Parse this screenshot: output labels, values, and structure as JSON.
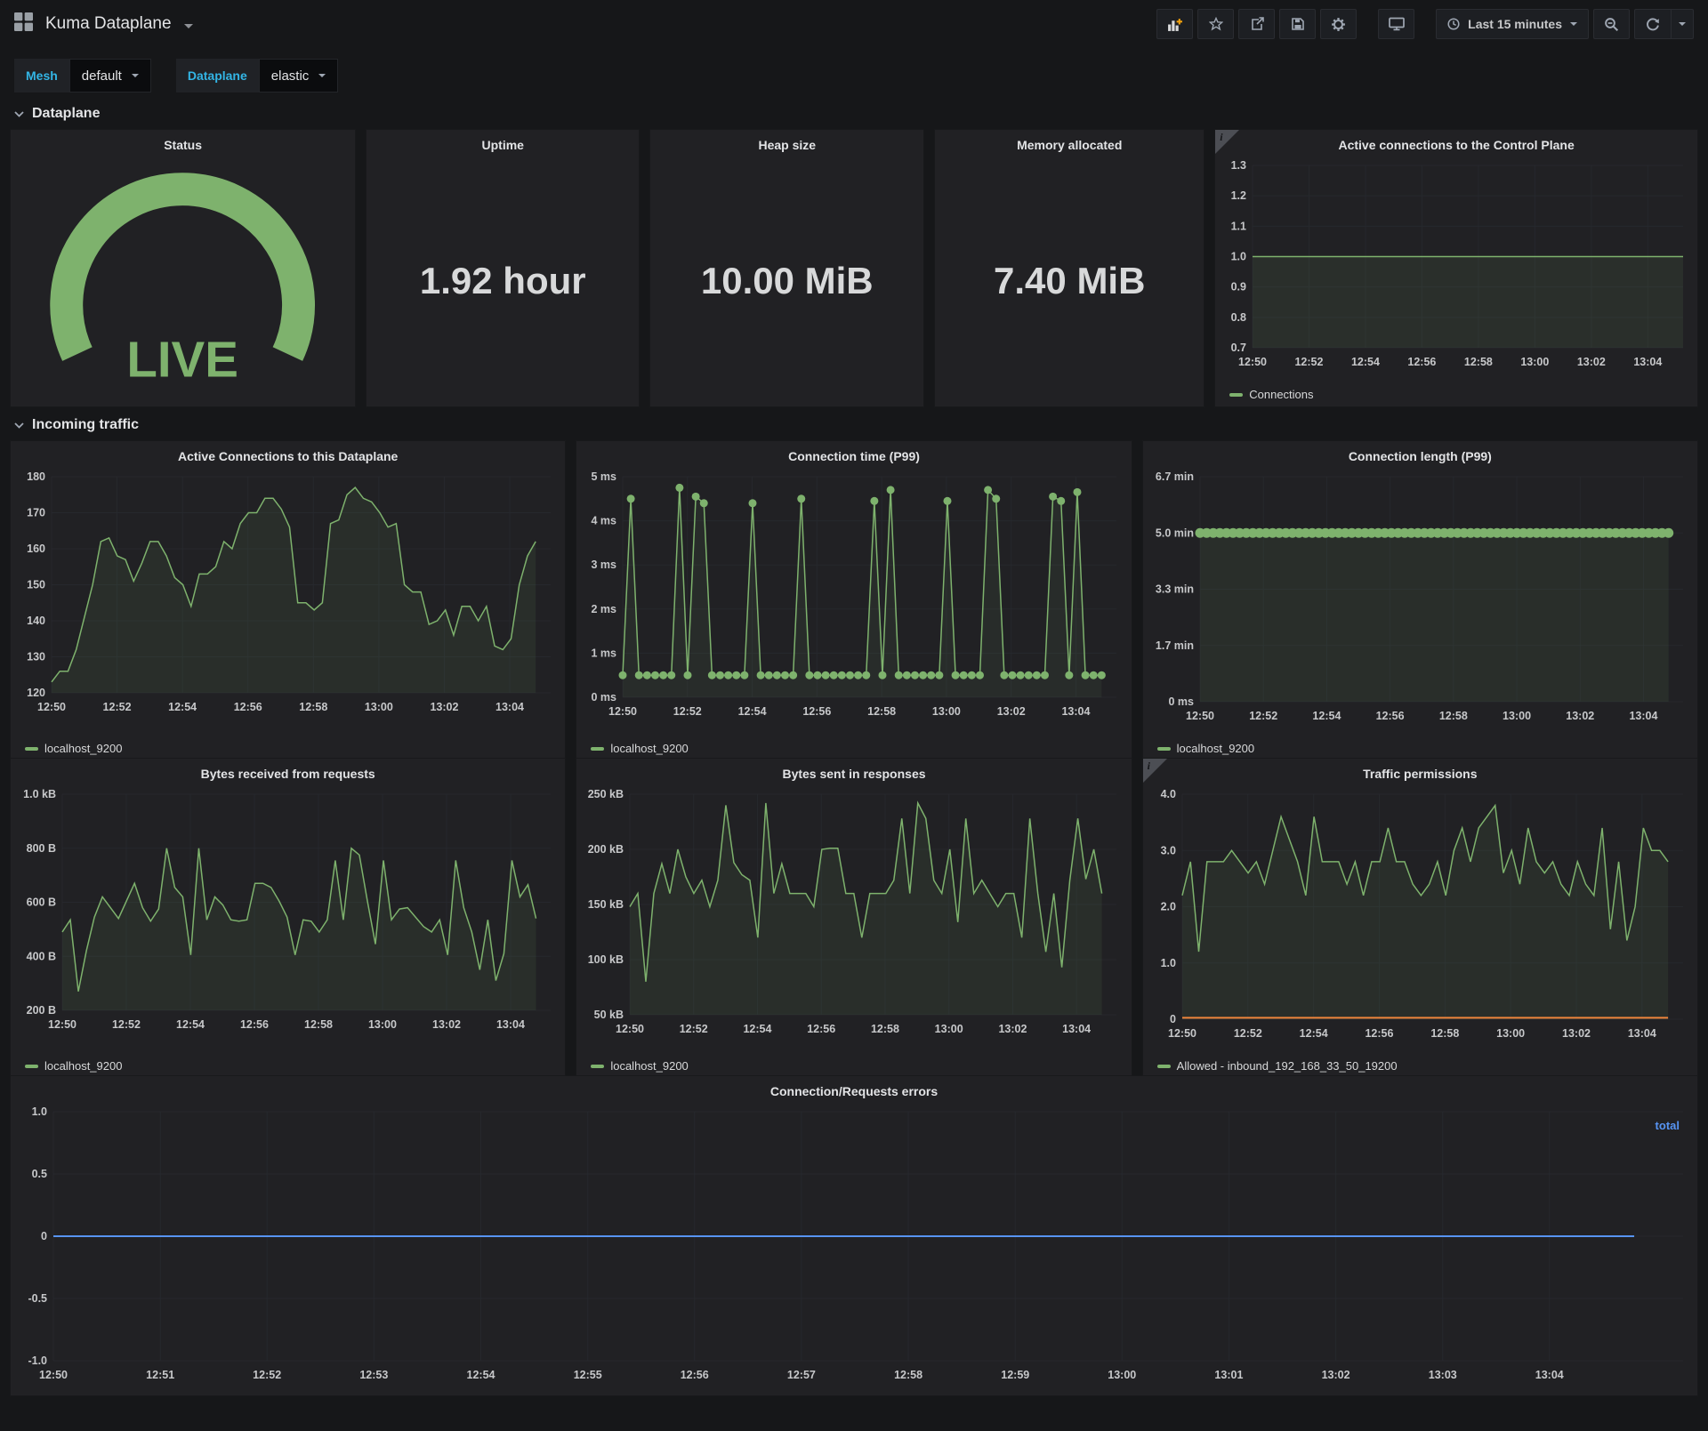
{
  "header": {
    "title": "Kuma Dataplane",
    "time_range": "Last 15 minutes",
    "buttons": [
      "add-panel",
      "star",
      "share",
      "save",
      "settings",
      "cycle-view",
      "time-picker",
      "zoom-out",
      "refresh"
    ]
  },
  "variables": [
    {
      "label": "Mesh",
      "value": "default"
    },
    {
      "label": "Dataplane",
      "value": "elastic"
    }
  ],
  "sections": {
    "dataplane": "Dataplane",
    "incoming": "Incoming traffic"
  },
  "colors": {
    "green": "#7EB26D",
    "blue": "#5794F2",
    "orange": "#EF843C",
    "cyan": "#33B5E5"
  },
  "stats": {
    "status": {
      "title": "Status",
      "value": "LIVE"
    },
    "uptime": {
      "title": "Uptime",
      "value": "1.92 hour"
    },
    "heap": {
      "title": "Heap size",
      "value": "10.00 MiB"
    },
    "memory": {
      "title": "Memory allocated",
      "value": "7.40 MiB"
    }
  },
  "chart_data": [
    {
      "id": "cp-connections",
      "type": "line",
      "title": "Active connections to the Control Plane",
      "ylabel": "",
      "xlabel": "",
      "ylim": [
        0.7,
        1.3
      ],
      "ml": 42,
      "span": 1,
      "yticks": [
        {
          "v": 1.3,
          "label": "1.3"
        },
        {
          "v": 1.2,
          "label": "1.2"
        },
        {
          "v": 1.1,
          "label": "1.1"
        },
        {
          "v": 1.0,
          "label": "1.0"
        },
        {
          "v": 0.9,
          "label": "0.9"
        },
        {
          "v": 0.8,
          "label": "0.8"
        },
        {
          "v": 0.7,
          "label": "0.7"
        }
      ],
      "xticks": [
        {
          "f": 0,
          "label": "12:50"
        },
        {
          "f": 0.1311,
          "label": "12:52"
        },
        {
          "f": 0.2623,
          "label": "12:54"
        },
        {
          "f": 0.3934,
          "label": "12:56"
        },
        {
          "f": 0.5246,
          "label": "12:58"
        },
        {
          "f": 0.6557,
          "label": "13:00"
        },
        {
          "f": 0.7869,
          "label": "13:02"
        },
        {
          "f": 0.918,
          "label": "13:04"
        }
      ],
      "series": [
        {
          "name": "Connections",
          "color": "#7EB26D",
          "fill": 0.1,
          "width": 1.5,
          "flat": {
            "value": 1.0,
            "count": 60
          }
        }
      ]
    },
    {
      "id": "active-connections",
      "type": "line",
      "title": "Active Connections to this Dataplane",
      "ylim": [
        120,
        180
      ],
      "ml": 46,
      "span": 0.97,
      "yticks": [
        {
          "v": 180,
          "label": "180"
        },
        {
          "v": 170,
          "label": "170"
        },
        {
          "v": 160,
          "label": "160"
        },
        {
          "v": 150,
          "label": "150"
        },
        {
          "v": 140,
          "label": "140"
        },
        {
          "v": 130,
          "label": "130"
        },
        {
          "v": 120,
          "label": "120"
        }
      ],
      "xticks": [
        {
          "f": 0,
          "label": "12:50"
        },
        {
          "f": 0.1311,
          "label": "12:52"
        },
        {
          "f": 0.2623,
          "label": "12:54"
        },
        {
          "f": 0.3934,
          "label": "12:56"
        },
        {
          "f": 0.5246,
          "label": "12:58"
        },
        {
          "f": 0.6557,
          "label": "13:00"
        },
        {
          "f": 0.7869,
          "label": "13:02"
        },
        {
          "f": 0.918,
          "label": "13:04"
        }
      ],
      "series": [
        {
          "name": "localhost_9200",
          "color": "#7EB26D",
          "fill": 0.09,
          "width": 1.5,
          "values": [
            123,
            126,
            126,
            132,
            141,
            150,
            162,
            163,
            158,
            157,
            151,
            156,
            162,
            162,
            158,
            152,
            150,
            144,
            153,
            153,
            155,
            162,
            160,
            167,
            170,
            170,
            174,
            174,
            171,
            166,
            145,
            145,
            143,
            145,
            167,
            168,
            175,
            177,
            174,
            173,
            170,
            166,
            167,
            150,
            148,
            148,
            139,
            140,
            143,
            136,
            144,
            144,
            140,
            144,
            133,
            132,
            135,
            150,
            158,
            162
          ]
        }
      ]
    },
    {
      "id": "connection-time",
      "type": "line",
      "title": "Connection time (P99)",
      "ylim": [
        0,
        5
      ],
      "ml": 52,
      "span": 0.97,
      "yticks": [
        {
          "v": 5,
          "label": "5 ms"
        },
        {
          "v": 4,
          "label": "4 ms"
        },
        {
          "v": 3,
          "label": "3 ms"
        },
        {
          "v": 2,
          "label": "2 ms"
        },
        {
          "v": 1,
          "label": "1 ms"
        },
        {
          "v": 0,
          "label": "0 ms"
        }
      ],
      "xticks": [
        {
          "f": 0,
          "label": "12:50"
        },
        {
          "f": 0.1311,
          "label": "12:52"
        },
        {
          "f": 0.2623,
          "label": "12:54"
        },
        {
          "f": 0.3934,
          "label": "12:56"
        },
        {
          "f": 0.5246,
          "label": "12:58"
        },
        {
          "f": 0.6557,
          "label": "13:00"
        },
        {
          "f": 0.7869,
          "label": "13:02"
        },
        {
          "f": 0.918,
          "label": "13:04"
        }
      ],
      "series": [
        {
          "name": "localhost_9200",
          "color": "#7EB26D",
          "fill": 0.08,
          "width": 1.5,
          "marker": 4.5,
          "values": [
            0.5,
            4.5,
            0.5,
            0.5,
            0.5,
            0.5,
            0.5,
            4.75,
            0.5,
            4.55,
            4.4,
            0.5,
            0.5,
            0.5,
            0.5,
            0.5,
            4.4,
            0.5,
            0.5,
            0.5,
            0.5,
            0.5,
            4.5,
            0.5,
            0.5,
            0.5,
            0.5,
            0.5,
            0.5,
            0.5,
            0.5,
            4.45,
            0.5,
            4.7,
            0.5,
            0.5,
            0.5,
            0.5,
            0.5,
            0.5,
            4.45,
            0.5,
            0.5,
            0.5,
            0.5,
            4.7,
            4.5,
            0.5,
            0.5,
            0.5,
            0.5,
            0.5,
            0.5,
            4.55,
            4.45,
            0.5,
            4.65,
            0.5,
            0.5,
            0.5
          ]
        }
      ]
    },
    {
      "id": "connection-length",
      "type": "line",
      "title": "Connection length (P99)",
      "ylim": [
        0,
        400
      ],
      "ml": 64,
      "span": 0.97,
      "yticks": [
        {
          "v": 400,
          "label": "6.7 min"
        },
        {
          "v": 300,
          "label": "5.0 min"
        },
        {
          "v": 200,
          "label": "3.3 min"
        },
        {
          "v": 100,
          "label": "1.7 min"
        },
        {
          "v": 0,
          "label": "0 ms"
        }
      ],
      "xticks": [
        {
          "f": 0,
          "label": "12:50"
        },
        {
          "f": 0.1311,
          "label": "12:52"
        },
        {
          "f": 0.2623,
          "label": "12:54"
        },
        {
          "f": 0.3934,
          "label": "12:56"
        },
        {
          "f": 0.5246,
          "label": "12:58"
        },
        {
          "f": 0.6557,
          "label": "13:00"
        },
        {
          "f": 0.7869,
          "label": "13:02"
        },
        {
          "f": 0.918,
          "label": "13:04"
        }
      ],
      "series": [
        {
          "name": "localhost_9200",
          "color": "#7EB26D",
          "fill": 0.09,
          "width": 1.5,
          "marker": 5.5,
          "flat": {
            "value": 300,
            "count": 72
          }
        }
      ]
    },
    {
      "id": "bytes-received",
      "type": "line",
      "title": "Bytes received from requests",
      "ylim": [
        200,
        1000
      ],
      "ml": 58,
      "span": 0.97,
      "yticks": [
        {
          "v": 1000,
          "label": "1.0 kB"
        },
        {
          "v": 800,
          "label": "800 B"
        },
        {
          "v": 600,
          "label": "600 B"
        },
        {
          "v": 400,
          "label": "400 B"
        },
        {
          "v": 200,
          "label": "200 B"
        }
      ],
      "xticks": [
        {
          "f": 0,
          "label": "12:50"
        },
        {
          "f": 0.1311,
          "label": "12:52"
        },
        {
          "f": 0.2623,
          "label": "12:54"
        },
        {
          "f": 0.3934,
          "label": "12:56"
        },
        {
          "f": 0.5246,
          "label": "12:58"
        },
        {
          "f": 0.6557,
          "label": "13:00"
        },
        {
          "f": 0.7869,
          "label": "13:02"
        },
        {
          "f": 0.918,
          "label": "13:04"
        }
      ],
      "series": [
        {
          "name": "localhost_9200",
          "color": "#7EB26D",
          "fill": 0.09,
          "width": 1.5,
          "values": [
            490,
            535,
            270,
            420,
            545,
            620,
            580,
            540,
            605,
            670,
            580,
            530,
            575,
            800,
            655,
            620,
            405,
            800,
            535,
            620,
            590,
            535,
            530,
            535,
            670,
            670,
            655,
            605,
            545,
            405,
            535,
            530,
            490,
            535,
            755,
            535,
            800,
            775,
            605,
            445,
            755,
            535,
            575,
            580,
            545,
            510,
            490,
            535,
            405,
            755,
            580,
            490,
            350,
            535,
            310,
            410,
            755,
            620,
            665,
            540
          ]
        }
      ]
    },
    {
      "id": "bytes-sent",
      "type": "line",
      "title": "Bytes sent in responses",
      "ylim": [
        50,
        250
      ],
      "ml": 60,
      "span": 0.97,
      "yticks": [
        {
          "v": 250,
          "label": "250 kB"
        },
        {
          "v": 200,
          "label": "200 kB"
        },
        {
          "v": 150,
          "label": "150 kB"
        },
        {
          "v": 100,
          "label": "100 kB"
        },
        {
          "v": 50,
          "label": "50 kB"
        }
      ],
      "xticks": [
        {
          "f": 0,
          "label": "12:50"
        },
        {
          "f": 0.1311,
          "label": "12:52"
        },
        {
          "f": 0.2623,
          "label": "12:54"
        },
        {
          "f": 0.3934,
          "label": "12:56"
        },
        {
          "f": 0.5246,
          "label": "12:58"
        },
        {
          "f": 0.6557,
          "label": "13:00"
        },
        {
          "f": 0.7869,
          "label": "13:02"
        },
        {
          "f": 0.918,
          "label": "13:04"
        }
      ],
      "series": [
        {
          "name": "localhost_9200",
          "color": "#7EB26D",
          "fill": 0.09,
          "width": 1.5,
          "values": [
            148,
            160,
            80,
            160,
            187,
            160,
            200,
            175,
            160,
            172,
            148,
            172,
            240,
            188,
            177,
            172,
            120,
            242,
            160,
            187,
            160,
            160,
            160,
            148,
            200,
            201,
            201,
            160,
            160,
            120,
            160,
            160,
            160,
            172,
            228,
            160,
            242,
            228,
            172,
            160,
            200,
            134,
            228,
            160,
            172,
            160,
            148,
            160,
            160,
            120,
            228,
            160,
            107,
            160,
            93,
            172,
            228,
            173,
            200,
            160
          ]
        }
      ]
    },
    {
      "id": "traffic-permissions",
      "type": "line",
      "title": "Traffic permissions",
      "ylim": [
        0,
        4
      ],
      "ml": 44,
      "span": 0.97,
      "yticks": [
        {
          "v": 4,
          "label": "4.0"
        },
        {
          "v": 3,
          "label": "3.0"
        },
        {
          "v": 2,
          "label": "2.0"
        },
        {
          "v": 1,
          "label": "1.0"
        },
        {
          "v": 0,
          "label": "0"
        }
      ],
      "xticks": [
        {
          "f": 0,
          "label": "12:50"
        },
        {
          "f": 0.1311,
          "label": "12:52"
        },
        {
          "f": 0.2623,
          "label": "12:54"
        },
        {
          "f": 0.3934,
          "label": "12:56"
        },
        {
          "f": 0.5246,
          "label": "12:58"
        },
        {
          "f": 0.6557,
          "label": "13:00"
        },
        {
          "f": 0.7869,
          "label": "13:02"
        },
        {
          "f": 0.918,
          "label": "13:04"
        }
      ],
      "series": [
        {
          "name": "Allowed - inbound_192_168_33_50_19200",
          "color": "#7EB26D",
          "fill": 0.09,
          "width": 1.5,
          "values": [
            2.2,
            2.8,
            1.2,
            2.8,
            2.8,
            2.8,
            3.0,
            2.8,
            2.6,
            2.8,
            2.4,
            3.0,
            3.6,
            3.2,
            2.8,
            2.2,
            3.6,
            2.8,
            2.8,
            2.8,
            2.4,
            2.8,
            2.2,
            2.8,
            2.8,
            3.4,
            2.8,
            2.8,
            2.4,
            2.2,
            2.4,
            2.8,
            2.2,
            3.0,
            3.4,
            2.8,
            3.4,
            3.6,
            3.8,
            2.6,
            3.0,
            2.4,
            3.4,
            2.8,
            2.6,
            2.8,
            2.4,
            2.2,
            2.8,
            2.4,
            2.2,
            3.4,
            1.6,
            2.8,
            1.4,
            2.0,
            3.4,
            3.0,
            3.0,
            2.8
          ]
        },
        {
          "name": "blocked-baseline",
          "legend": false,
          "color": "#EF843C",
          "width": 2,
          "flat": {
            "value": 0.025,
            "count": 2
          }
        }
      ]
    },
    {
      "id": "errors",
      "type": "line",
      "title": "Connection/Requests errors",
      "ylim": [
        -1,
        1
      ],
      "ml": 48,
      "span": 0.97,
      "yticks": [
        {
          "v": 1,
          "label": "1.0"
        },
        {
          "v": 0.5,
          "label": "0.5"
        },
        {
          "v": 0,
          "label": "0"
        },
        {
          "v": -0.5,
          "label": "-0.5"
        },
        {
          "v": -1,
          "label": "-1.0"
        }
      ],
      "xticks": [
        {
          "f": 0,
          "label": "12:50"
        },
        {
          "f": 0.0656,
          "label": "12:51"
        },
        {
          "f": 0.1311,
          "label": "12:52"
        },
        {
          "f": 0.1967,
          "label": "12:53"
        },
        {
          "f": 0.2623,
          "label": "12:54"
        },
        {
          "f": 0.3279,
          "label": "12:55"
        },
        {
          "f": 0.3934,
          "label": "12:56"
        },
        {
          "f": 0.459,
          "label": "12:57"
        },
        {
          "f": 0.5246,
          "label": "12:58"
        },
        {
          "f": 0.5902,
          "label": "12:59"
        },
        {
          "f": 0.6557,
          "label": "13:00"
        },
        {
          "f": 0.7213,
          "label": "13:01"
        },
        {
          "f": 0.7869,
          "label": "13:02"
        },
        {
          "f": 0.8525,
          "label": "13:03"
        },
        {
          "f": 0.918,
          "label": "13:04"
        }
      ],
      "series": [
        {
          "name": "total",
          "color": "#5794F2",
          "width": 2,
          "flat": {
            "value": 0,
            "count": 2
          }
        }
      ]
    }
  ]
}
